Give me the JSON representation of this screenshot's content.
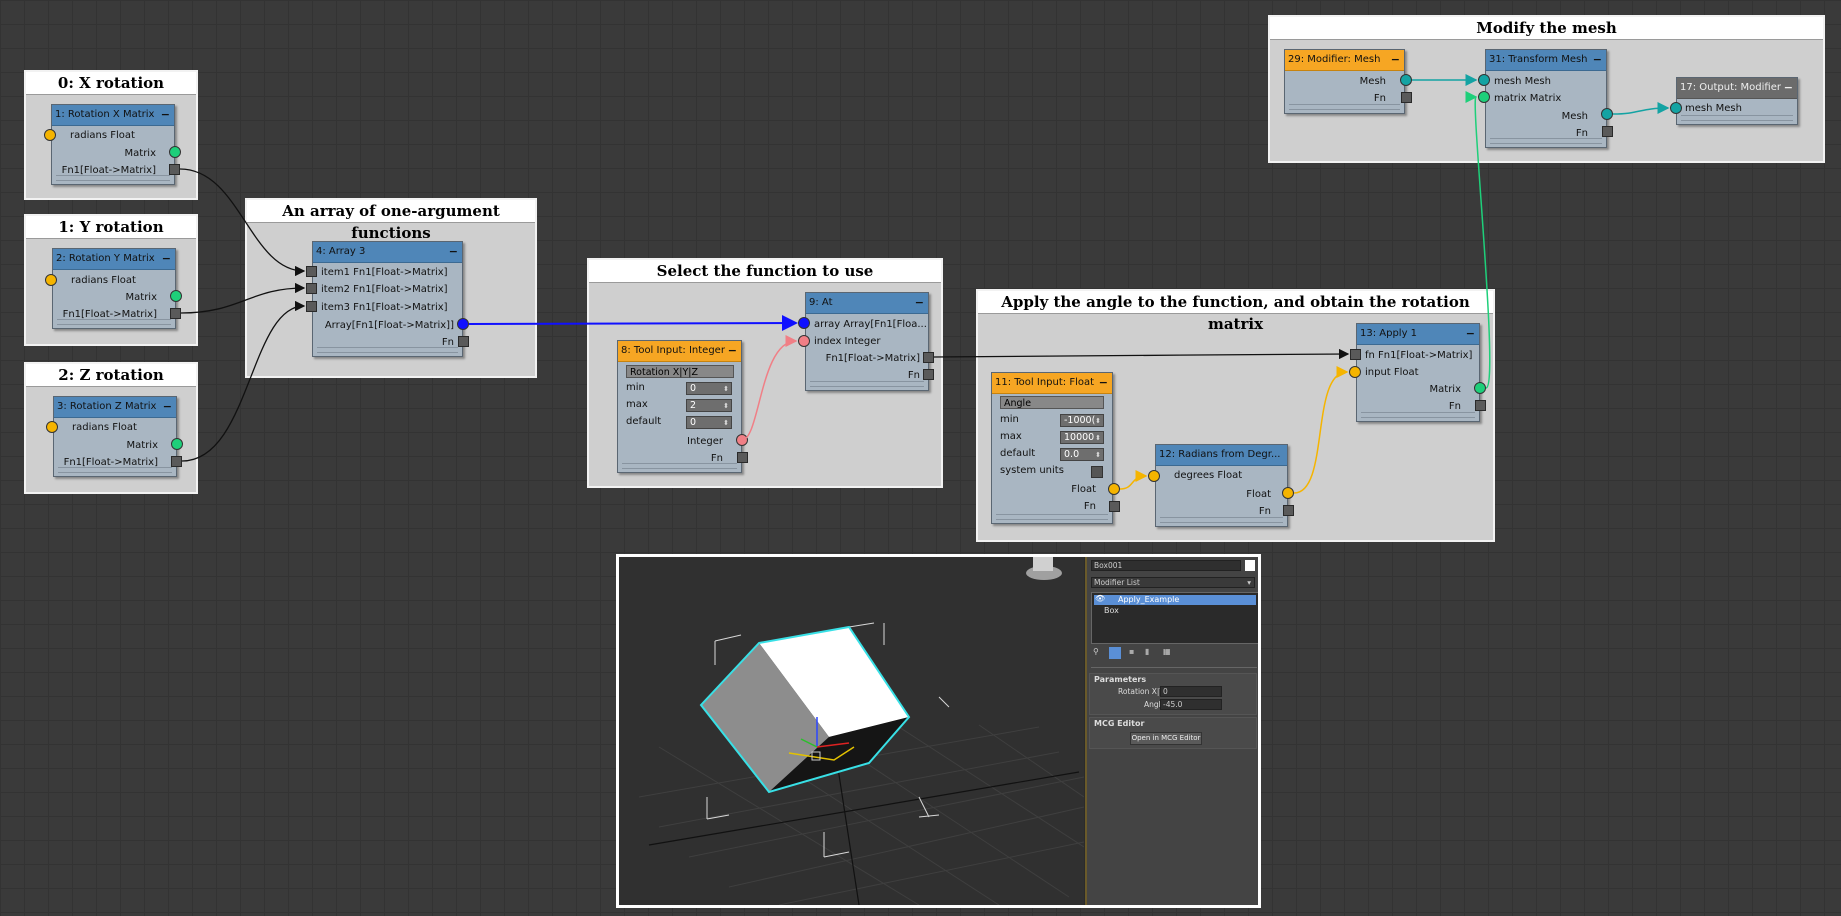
{
  "groups": {
    "x_rotation": {
      "title": "0: X rotation"
    },
    "y_rotation": {
      "title": "1: Y rotation"
    },
    "z_rotation": {
      "title": "2: Z rotation"
    },
    "array": {
      "title": "An array of one-argument functions"
    },
    "select": {
      "title": "Select the function to use"
    },
    "apply": {
      "title": "Apply the angle to the function, and obtain the rotation matrix"
    },
    "modify": {
      "title": "Modify the mesh"
    }
  },
  "nodes": {
    "rotx": {
      "title": "1: Rotation X Matrix",
      "in1": "radians Float",
      "out1": "Matrix",
      "out2": "Fn1[Float->Matrix]"
    },
    "roty": {
      "title": "2: Rotation Y Matrix",
      "in1": "radians Float",
      "out1": "Matrix",
      "out2": "Fn1[Float->Matrix]"
    },
    "rotz": {
      "title": "3: Rotation Z Matrix",
      "in1": "radians Float",
      "out1": "Matrix",
      "out2": "Fn1[Float->Matrix]"
    },
    "array3": {
      "title": "4: Array 3",
      "in1": "item1 Fn1[Float->Matrix]",
      "in2": "item2 Fn1[Float->Matrix]",
      "in3": "item3 Fn1[Float->Matrix]",
      "out1": "Array[Fn1[Float->Matrix]]",
      "out2": "Fn"
    },
    "at": {
      "title": "9: At",
      "in1": "array Array[Fn1[Floa...",
      "in2": "index Integer",
      "out1": "Fn1[Float->Matrix]",
      "out2": "Fn"
    },
    "toolint": {
      "title": "8: Tool Input: Integer",
      "name": "Rotation X|Y|Z",
      "min_label": "min",
      "min": "0",
      "max_label": "max",
      "max": "2",
      "default_label": "default",
      "default": "0",
      "out1": "Integer",
      "out2": "Fn"
    },
    "toolfloat": {
      "title": "11: Tool Input: Float",
      "name": "Angle",
      "min_label": "min",
      "min": "-1000(",
      "max_label": "max",
      "max": "10000",
      "default_label": "default",
      "default": "0.0",
      "sys_label": "system units",
      "out1": "Float",
      "out2": "Fn"
    },
    "radians": {
      "title": "12: Radians from Degr...",
      "in1": "degrees Float",
      "out1": "Float",
      "out2": "Fn"
    },
    "apply1": {
      "title": "13: Apply 1",
      "in1": "fn Fn1[Float->Matrix]",
      "in2": "input Float",
      "out1": "Matrix",
      "out2": "Fn"
    },
    "modmesh": {
      "title": "29: Modifier: Mesh",
      "out1": "Mesh",
      "out2": "Fn"
    },
    "transform": {
      "title": "31: Transform Mesh",
      "in1": "mesh Mesh",
      "in2": "matrix Matrix",
      "out1": "Mesh",
      "out2": "Fn"
    },
    "output": {
      "title": "17: Output: Modifier",
      "in1": "mesh Mesh"
    }
  },
  "colors": {
    "float_port": "#f5b400",
    "matrix_port": "#1ecf7a",
    "mesh_port": "#14a3a3",
    "array_port": "#1010ff",
    "integer_port": "#f07f86",
    "node_header": "#4f86b8",
    "tool_header": "#f6a623"
  },
  "viewport": {
    "object_name": "Box001",
    "modifier_list": "Modifier List",
    "stack": [
      "Apply_Example",
      "Box"
    ],
    "parameters_title": "Parameters",
    "param_rotation_label": "Rotation X|Y|Z",
    "param_rotation_value": "0",
    "param_angle_label": "Angle",
    "param_angle_value": "-45.0",
    "mcg_title": "MCG Editor",
    "open_button": "Open in MCG Editor"
  }
}
